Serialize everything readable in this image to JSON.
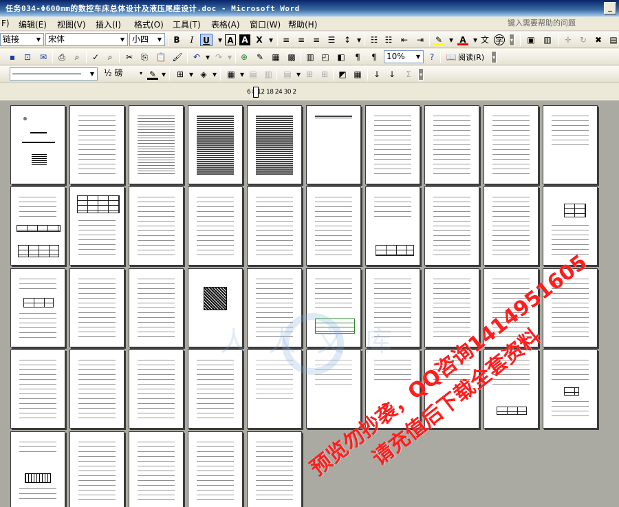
{
  "window": {
    "title": "任务034-Φ600mm的数控车床总体设计及液压尾座设计.doc - Microsoft Word",
    "min_glyph": "_"
  },
  "menu": {
    "items": [
      "F)",
      "编辑(E)",
      "视图(V)",
      "插入(I)",
      "格式(O)",
      "工具(T)",
      "表格(A)",
      "窗口(W)",
      "帮助(H)"
    ],
    "help_placeholder": "键入需要帮助的问题"
  },
  "format_toolbar": {
    "style": "链接",
    "font": "宋体",
    "size": "小四",
    "bold": "B",
    "italic": "I",
    "underline": "U"
  },
  "standard_toolbar": {
    "zoom": "10%",
    "read_button": "阅读(R)"
  },
  "drawing_toolbar": {
    "line_weight": "½ 磅"
  },
  "ruler": {
    "scale": "6  8  12 18 24 30    2"
  },
  "watermark": {
    "line1": "预览勿抄袭，QQ咨询1414951605",
    "line2": "请充值后下载全套资料",
    "site": "人人文库"
  },
  "document": {
    "page_count": 44,
    "pages_per_row": 10
  }
}
